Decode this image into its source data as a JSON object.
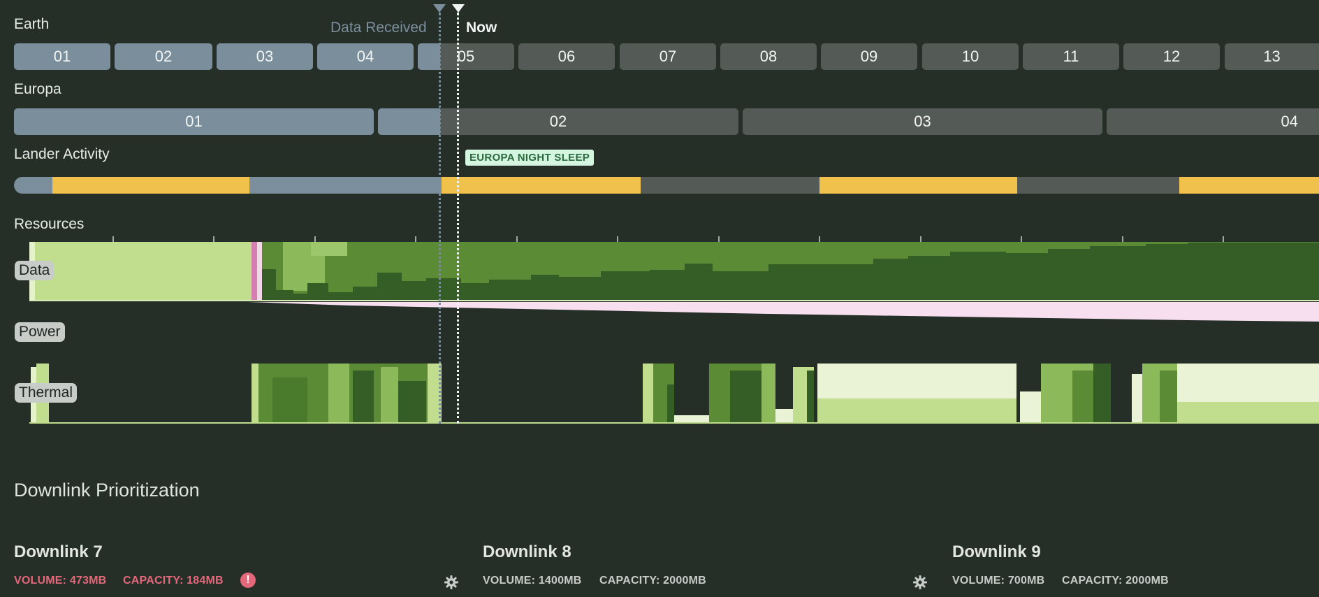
{
  "rows": {
    "earth": {
      "label": "Earth",
      "segments": [
        "01",
        "02",
        "03",
        "04",
        "05",
        "06",
        "07",
        "08",
        "09",
        "10",
        "11",
        "12",
        "13"
      ]
    },
    "europa": {
      "label": "Europa",
      "segments": [
        "01",
        "02",
        "03",
        "04"
      ]
    },
    "lander": {
      "label": "Lander Activity",
      "tag": "EUROPA NIGHT SLEEP"
    },
    "resources": {
      "label": "Resources",
      "pills": [
        "Data",
        "Power",
        "Thermal"
      ]
    }
  },
  "markers": {
    "data_received": "Data Received",
    "now": "Now"
  },
  "colors": {
    "past_segment": "#7a8e9b",
    "future_segment": "#545a55",
    "activity_active": "#f0c24b",
    "data_high": "#c1de8f",
    "data_mid": "#5b8b34",
    "data_low": "#355e26",
    "power": "#f7dff0",
    "warning": "#e2687a"
  },
  "downlink": {
    "heading": "Downlink Prioritization",
    "cards": [
      {
        "title": "Downlink 7",
        "volume": "VOLUME: 473MB",
        "capacity": "CAPACITY: 184MB",
        "warning_icon": "alert-icon"
      },
      {
        "title": "Downlink 8",
        "volume": "VOLUME: 1400MB",
        "capacity": "CAPACITY: 2000MB"
      },
      {
        "title": "Downlink 9",
        "volume": "VOLUME: 700MB",
        "capacity": "CAPACITY: 2000MB"
      }
    ]
  }
}
